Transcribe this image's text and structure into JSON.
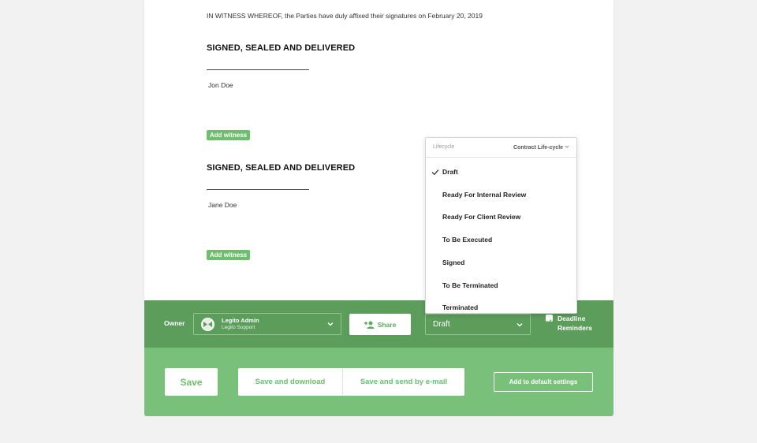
{
  "document": {
    "witness_line": "IN WITNESS WHEREOF, the Parties have duly affixed their signatures on  February 20, 2019",
    "blocks": [
      {
        "heading": "SIGNED, SEALED AND DELIVERED",
        "name": "Jon Doe",
        "add_witness": "Add witness"
      },
      {
        "heading": "SIGNED, SEALED AND DELIVERED",
        "name": "Jane Doe",
        "add_witness": "Add witness"
      }
    ]
  },
  "owner_bar": {
    "owner_label": "Owner",
    "owner_name": "Legito Admin",
    "owner_sub": "Legito Support",
    "share_label": "Share",
    "status_value": "Draft",
    "reminder_label_1": "Deadline",
    "reminder_label_2": "Reminders",
    "reminder_checked": true
  },
  "lifecycle_dropdown": {
    "header_label": "Lifecycle",
    "header_value": "Contract Life-cycle",
    "selected": "Draft",
    "items": [
      "Draft",
      "Ready For Internal Review",
      "Ready For Client Review",
      "To Be Executed",
      "Signed",
      "To Be Terminated",
      "Terminated"
    ]
  },
  "action_bar": {
    "save": "Save",
    "save_and_download": "Save and download",
    "save_and_send": "Save and send by e-mail",
    "add_default": "Add to default settings"
  },
  "colors": {
    "green_dark": "#5c9d5c",
    "green_light": "#79c07a",
    "green_accent": "#6cbf6c"
  }
}
